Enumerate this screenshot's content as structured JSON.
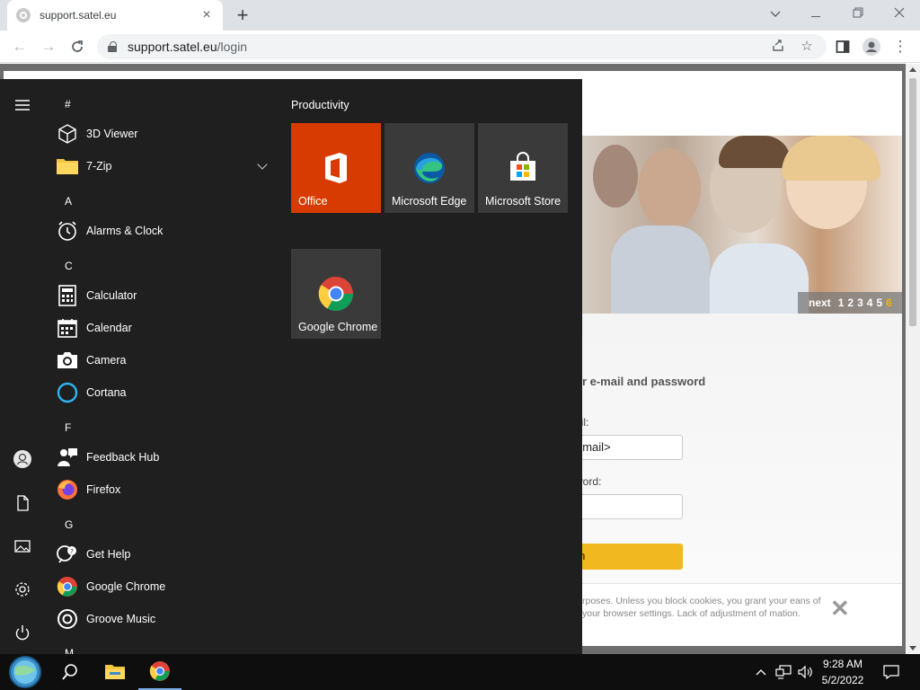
{
  "browser": {
    "tab_title": "support.satel.eu",
    "url_host": "support.satel.eu",
    "url_path": "/login"
  },
  "page": {
    "pager": {
      "next_label": "next",
      "pages": [
        "1",
        "2",
        "3",
        "4",
        "5",
        "6"
      ],
      "active_page": "6"
    },
    "login_title": "ur e-mail and password",
    "email_label": "ail:",
    "email_value": "gmail>",
    "password_label": "word:",
    "login_button": "in",
    "cookie_text": "rposes. Unless you block cookies, you grant your eans of your browser settings. Lack of adjustment of mation."
  },
  "start_menu": {
    "sections": [
      {
        "letter": "#",
        "apps": [
          {
            "label": "3D Viewer",
            "icon": "3d-viewer-icon"
          },
          {
            "label": "7-Zip",
            "icon": "folder-icon",
            "expandable": true
          }
        ]
      },
      {
        "letter": "A",
        "apps": [
          {
            "label": "Alarms & Clock",
            "icon": "alarm-clock-icon"
          }
        ]
      },
      {
        "letter": "C",
        "apps": [
          {
            "label": "Calculator",
            "icon": "calculator-icon"
          },
          {
            "label": "Calendar",
            "icon": "calendar-icon"
          },
          {
            "label": "Camera",
            "icon": "camera-icon"
          },
          {
            "label": "Cortana",
            "icon": "cortana-icon"
          }
        ]
      },
      {
        "letter": "F",
        "apps": [
          {
            "label": "Feedback Hub",
            "icon": "feedback-hub-icon"
          },
          {
            "label": "Firefox",
            "icon": "firefox-icon"
          }
        ]
      },
      {
        "letter": "G",
        "apps": [
          {
            "label": "Get Help",
            "icon": "get-help-icon"
          },
          {
            "label": "Google Chrome",
            "icon": "chrome-icon"
          },
          {
            "label": "Groove Music",
            "icon": "groove-music-icon"
          }
        ]
      },
      {
        "letter": "M",
        "apps": []
      }
    ],
    "group_title": "Productivity",
    "tiles": [
      {
        "label": "Office",
        "color": "#d83b01"
      },
      {
        "label": "Microsoft Edge",
        "color": "#3a3a3a"
      },
      {
        "label": "Microsoft Store",
        "color": "#3a3a3a"
      },
      {
        "label": "Google Chrome",
        "color": "#3a3a3a"
      }
    ]
  },
  "taskbar": {
    "time": "9:28 AM",
    "date": "5/2/2022"
  }
}
